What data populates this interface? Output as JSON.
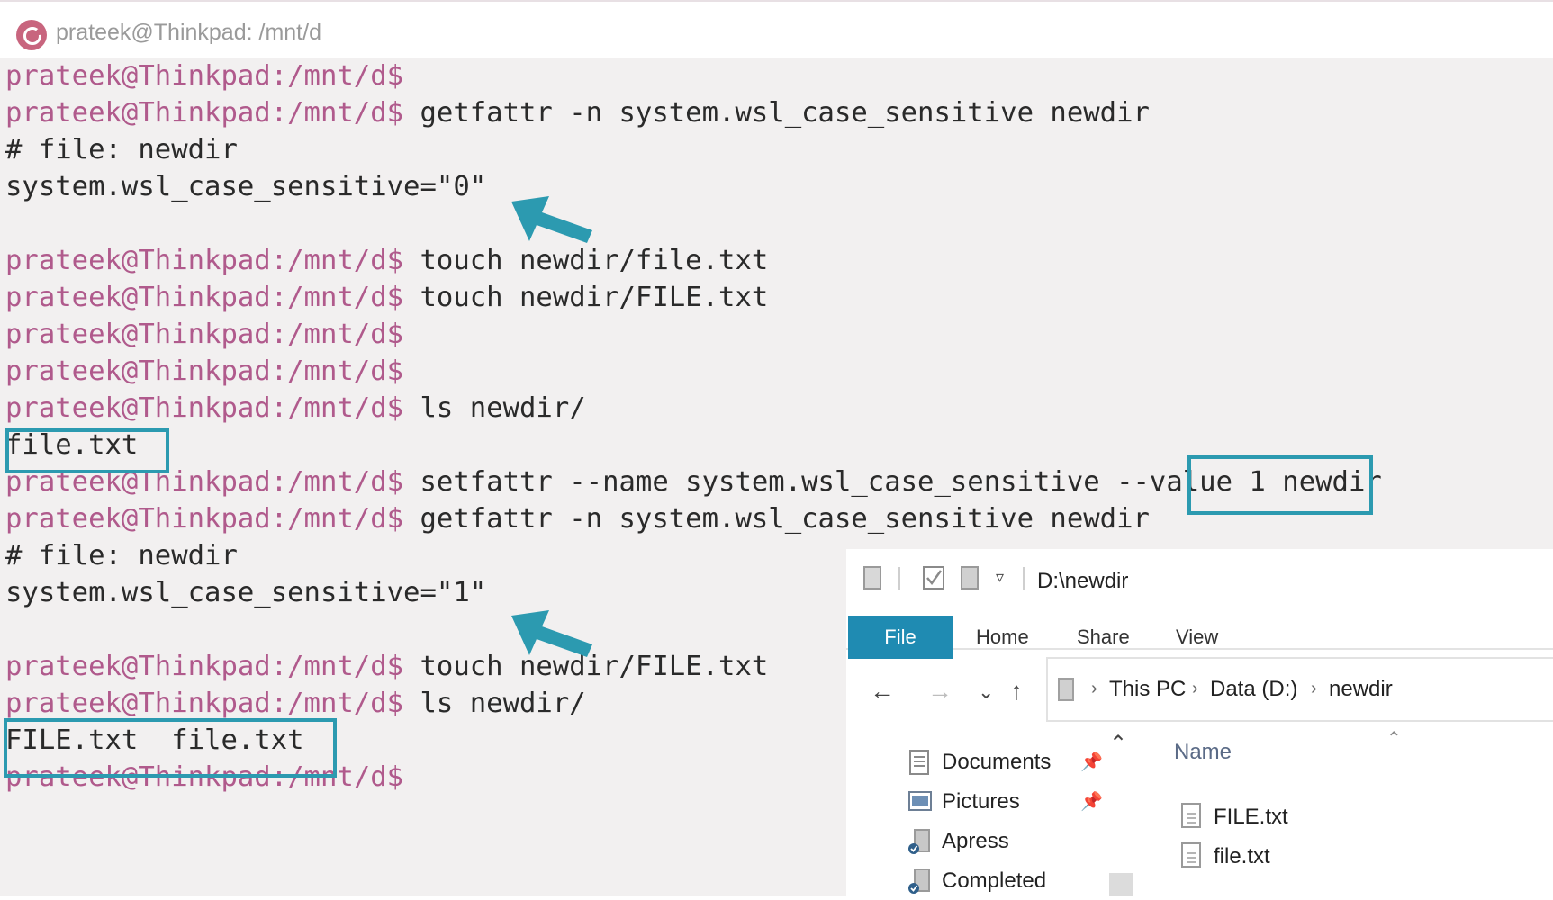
{
  "window": {
    "title": "prateek@Thinkpad: /mnt/d"
  },
  "terminal": {
    "lines": [
      {
        "prompt": "prateek@Thinkpad:/mnt/d$",
        "text": ""
      },
      {
        "prompt": "prateek@Thinkpad:/mnt/d$",
        "text": " getfattr -n system.wsl_case_sensitive newdir"
      },
      {
        "prompt": "",
        "text": "# file: newdir"
      },
      {
        "prompt": "",
        "text": "system.wsl_case_sensitive=\"0\""
      },
      {
        "prompt": "",
        "text": ""
      },
      {
        "prompt": "prateek@Thinkpad:/mnt/d$",
        "text": " touch newdir/file.txt"
      },
      {
        "prompt": "prateek@Thinkpad:/mnt/d$",
        "text": " touch newdir/FILE.txt"
      },
      {
        "prompt": "prateek@Thinkpad:/mnt/d$",
        "text": ""
      },
      {
        "prompt": "prateek@Thinkpad:/mnt/d$",
        "text": ""
      },
      {
        "prompt": "prateek@Thinkpad:/mnt/d$",
        "text": " ls newdir/"
      },
      {
        "prompt": "",
        "text": "file.txt"
      },
      {
        "prompt": "prateek@Thinkpad:/mnt/d$",
        "text": " setfattr --name system.wsl_case_sensitive --value 1 newdir"
      },
      {
        "prompt": "prateek@Thinkpad:/mnt/d$",
        "text": " getfattr -n system.wsl_case_sensitive newdir"
      },
      {
        "prompt": "",
        "text": "# file: newdir"
      },
      {
        "prompt": "",
        "text": "system.wsl_case_sensitive=\"1\""
      },
      {
        "prompt": "",
        "text": ""
      },
      {
        "prompt": "prateek@Thinkpad:/mnt/d$",
        "text": " touch newdir/FILE.txt"
      },
      {
        "prompt": "prateek@Thinkpad:/mnt/d$",
        "text": " ls newdir/"
      },
      {
        "prompt": "",
        "text": "FILE.txt  file.txt"
      },
      {
        "prompt": "prateek@Thinkpad:/mnt/d$",
        "text": ""
      }
    ]
  },
  "explorer": {
    "path_title": "D:\\newdir",
    "tabs": {
      "file": "File",
      "home": "Home",
      "share": "Share",
      "view": "View"
    },
    "breadcrumb": {
      "this_pc": "This PC",
      "drive": "Data (D:)",
      "folder": "newdir"
    },
    "nav_pane": [
      {
        "label": "Documents",
        "icon": "documents-icon",
        "pinned": true
      },
      {
        "label": "Pictures",
        "icon": "pictures-icon",
        "pinned": true
      },
      {
        "label": "Apress",
        "icon": "folder-icon",
        "pinned": false
      },
      {
        "label": "Completed",
        "icon": "folder-icon",
        "pinned": false
      }
    ],
    "column_header": "Name",
    "files": [
      "FILE.txt",
      "file.txt"
    ]
  },
  "colors": {
    "prompt": "#b05a8c",
    "highlight": "#2c9ab0",
    "terminal_bg": "#f2f0f0",
    "file_tab": "#1f8bb2"
  }
}
